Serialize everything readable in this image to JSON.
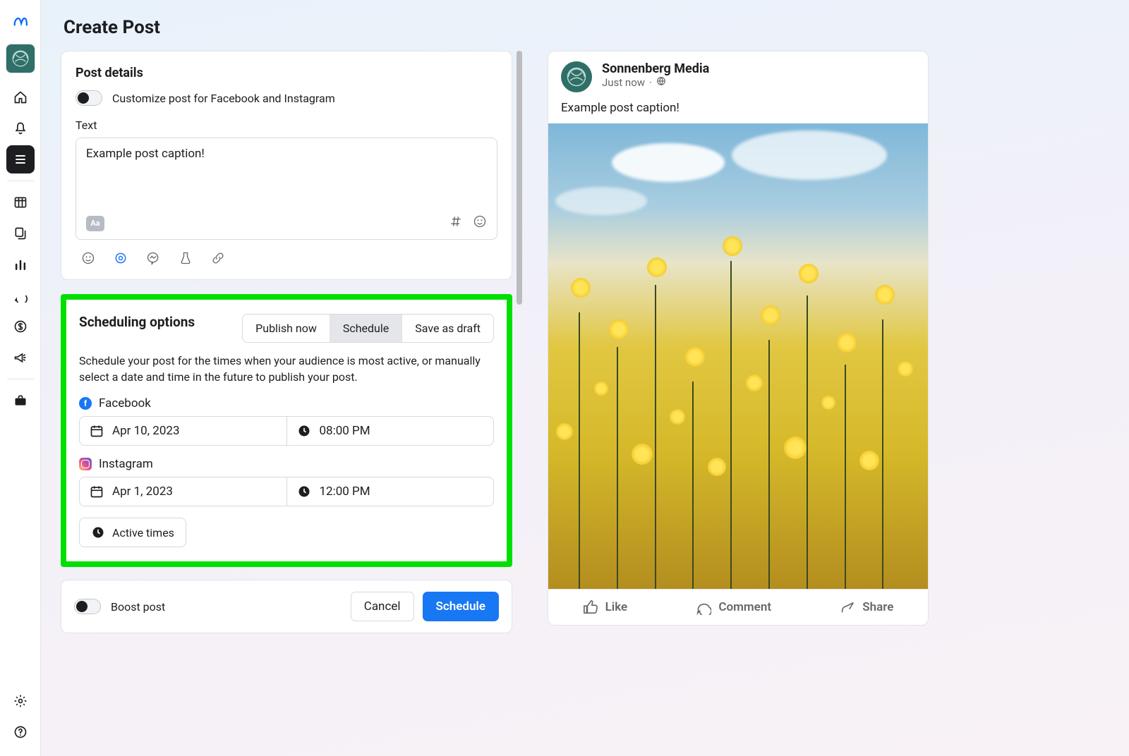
{
  "page": {
    "title": "Create Post"
  },
  "sidebar": {
    "icons": [
      "home",
      "bell",
      "menu",
      "grid",
      "copy",
      "chart",
      "comment",
      "dollar",
      "megaphone",
      "briefcase"
    ],
    "active_index": 2
  },
  "post_details": {
    "heading": "Post details",
    "customize_label": "Customize post for Facebook and Instagram",
    "text_label": "Text",
    "text_value": "Example post caption!"
  },
  "scheduling": {
    "heading": "Scheduling options",
    "tabs": {
      "publish": "Publish now",
      "schedule": "Schedule",
      "draft": "Save as draft"
    },
    "description": "Schedule your post for the times when your audience is most active, or manually select a date and time in the future to publish your post.",
    "facebook": {
      "label": "Facebook",
      "date": "Apr 10, 2023",
      "time": "08:00 PM"
    },
    "instagram": {
      "label": "Instagram",
      "date": "Apr 1, 2023",
      "time": "12:00 PM"
    },
    "active_times": "Active times"
  },
  "footer": {
    "boost_label": "Boost post",
    "cancel": "Cancel",
    "schedule": "Schedule"
  },
  "preview": {
    "author": "Sonnenberg Media",
    "timestamp": "Just now",
    "caption": "Example post caption!",
    "actions": {
      "like": "Like",
      "comment": "Comment",
      "share": "Share"
    }
  }
}
